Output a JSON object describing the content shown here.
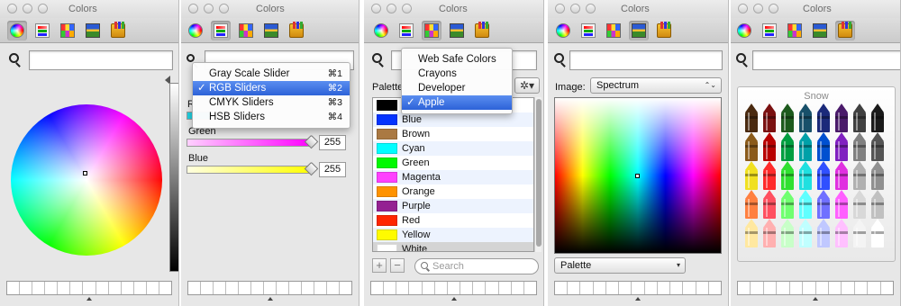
{
  "panels": [
    {
      "title": "Colors"
    },
    {
      "title": "Colors"
    },
    {
      "title": "Colors"
    },
    {
      "title": "Colors"
    },
    {
      "title": "Colors"
    }
  ],
  "toolbar_tools": [
    "color-wheel-icon",
    "color-sliders-icon",
    "color-palettes-icon",
    "image-palettes-icon",
    "crayons-icon"
  ],
  "rgb_panel": {
    "menu": [
      {
        "label": "Gray Scale Slider",
        "shortcut": "⌘1",
        "checked": false,
        "highlighted": false
      },
      {
        "label": "RGB Sliders",
        "shortcut": "⌘2",
        "checked": true,
        "highlighted": true
      },
      {
        "label": "CMYK Sliders",
        "shortcut": "⌘3",
        "checked": false,
        "highlighted": false
      },
      {
        "label": "HSB Sliders",
        "shortcut": "⌘4",
        "checked": false,
        "highlighted": false
      }
    ],
    "partial_label": "R",
    "check_mark": "✓",
    "sliders": [
      {
        "label": "Green",
        "value": "255",
        "level": 1.0,
        "color": "#ff00ff"
      },
      {
        "label": "Blue",
        "value": "255",
        "level": 1.0,
        "color": "#ffff00"
      }
    ]
  },
  "palette_panel": {
    "palette_label": "Palette",
    "gear_glyph": "✲▾",
    "menu": [
      {
        "label": "Web Safe Colors",
        "checked": false,
        "highlighted": false
      },
      {
        "label": "Crayons",
        "checked": false,
        "highlighted": false
      },
      {
        "label": "Developer",
        "checked": false,
        "highlighted": false
      },
      {
        "label": "Apple",
        "checked": true,
        "highlighted": true
      }
    ],
    "colors": [
      {
        "name": "",
        "hex": "#000000"
      },
      {
        "name": "Blue",
        "hex": "#0433ff"
      },
      {
        "name": "Brown",
        "hex": "#aa7942"
      },
      {
        "name": "Cyan",
        "hex": "#00fdff"
      },
      {
        "name": "Green",
        "hex": "#00f900"
      },
      {
        "name": "Magenta",
        "hex": "#ff40ff"
      },
      {
        "name": "Orange",
        "hex": "#ff9300"
      },
      {
        "name": "Purple",
        "hex": "#942192"
      },
      {
        "name": "Red",
        "hex": "#ff2600"
      },
      {
        "name": "Yellow",
        "hex": "#fffb00"
      },
      {
        "name": "White",
        "hex": "#ffffff"
      }
    ],
    "add_label": "+",
    "remove_label": "−",
    "search_placeholder": "Search"
  },
  "image_panel": {
    "image_label": "Image:",
    "image_value": "Spectrum",
    "select_arrows": "⌃⌄",
    "dropdown_arrow": "▾",
    "palette_select": "Palette"
  },
  "crayon_panel": {
    "selected_name": "Snow",
    "crayon_rows": [
      [
        "#4a2a10",
        "#7a1010",
        "#1d5a1d",
        "#18506a",
        "#1b2a7a",
        "#4a1a6a",
        "#404040",
        "#1a1a1a"
      ],
      [
        "#8a5a1a",
        "#b80000",
        "#009e40",
        "#00a0a8",
        "#0050d0",
        "#8020c0",
        "#808080",
        "#555555"
      ],
      [
        "#f0e020",
        "#ff2a2a",
        "#30e030",
        "#20e0e0",
        "#3050ff",
        "#e030e0",
        "#b0b0b0",
        "#909090"
      ],
      [
        "#ff8040",
        "#ff5060",
        "#70ff70",
        "#60ffff",
        "#7070ff",
        "#ff60ff",
        "#d8d8d8",
        "#c0c0c0"
      ],
      [
        "#ffe8a0",
        "#ffb0b0",
        "#c8ffc8",
        "#c0ffff",
        "#c0c8ff",
        "#ffc0ff",
        "#f4f4f4",
        "#ffffff"
      ]
    ]
  }
}
